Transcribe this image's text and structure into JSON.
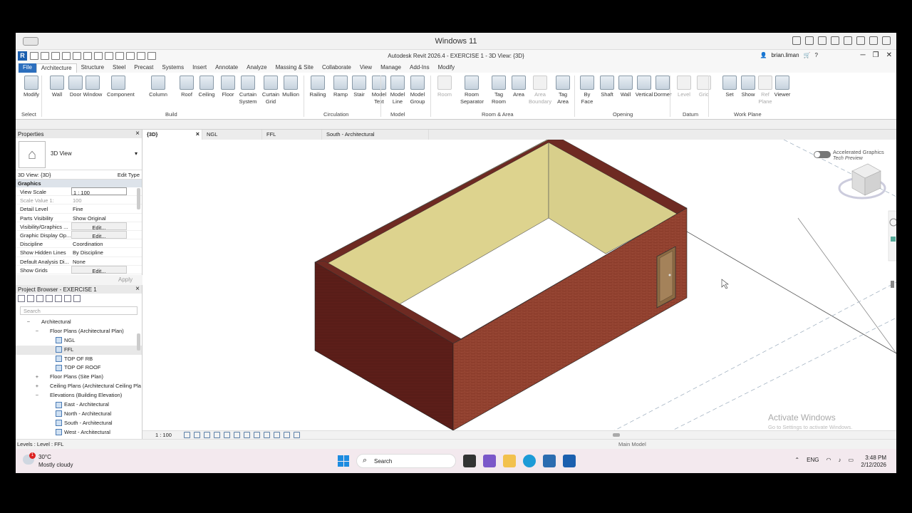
{
  "vm": {
    "title": "Windows 11"
  },
  "app": {
    "title": "Autodesk Revit 2026.4 - EXERCISE 1 - 3D View: {3D}",
    "user": "brian.liman",
    "logo": "R"
  },
  "tabs": [
    "File",
    "Architecture",
    "Structure",
    "Steel",
    "Precast",
    "Systems",
    "Insert",
    "Annotate",
    "Analyze",
    "Massing & Site",
    "Collaborate",
    "View",
    "Manage",
    "Add-Ins",
    "Modify"
  ],
  "ribbon": {
    "tools": [
      {
        "l1": "Modify",
        "l2": ""
      },
      {
        "l1": "Wall",
        "l2": ""
      },
      {
        "l1": "Door",
        "l2": ""
      },
      {
        "l1": "Window",
        "l2": ""
      },
      {
        "l1": "Component",
        "l2": ""
      },
      {
        "l1": "Column",
        "l2": ""
      },
      {
        "l1": "Roof",
        "l2": ""
      },
      {
        "l1": "Ceiling",
        "l2": ""
      },
      {
        "l1": "Floor",
        "l2": ""
      },
      {
        "l1": "Curtain",
        "l2": "System"
      },
      {
        "l1": "Curtain",
        "l2": "Grid"
      },
      {
        "l1": "Mullion",
        "l2": ""
      },
      {
        "l1": "Railing",
        "l2": ""
      },
      {
        "l1": "Ramp",
        "l2": ""
      },
      {
        "l1": "Stair",
        "l2": ""
      },
      {
        "l1": "Model",
        "l2": "Text"
      },
      {
        "l1": "Model",
        "l2": "Line"
      },
      {
        "l1": "Model",
        "l2": "Group"
      },
      {
        "l1": "Room",
        "l2": ""
      },
      {
        "l1": "Room",
        "l2": "Separator"
      },
      {
        "l1": "Tag",
        "l2": "Room"
      },
      {
        "l1": "Area",
        "l2": ""
      },
      {
        "l1": "Area",
        "l2": "Boundary"
      },
      {
        "l1": "Tag",
        "l2": "Area"
      },
      {
        "l1": "By",
        "l2": "Face"
      },
      {
        "l1": "Shaft",
        "l2": ""
      },
      {
        "l1": "Wall",
        "l2": ""
      },
      {
        "l1": "Vertical",
        "l2": ""
      },
      {
        "l1": "Dormer",
        "l2": ""
      },
      {
        "l1": "Level",
        "l2": ""
      },
      {
        "l1": "Grid",
        "l2": ""
      },
      {
        "l1": "Set",
        "l2": ""
      },
      {
        "l1": "Show",
        "l2": ""
      },
      {
        "l1": "Ref",
        "l2": "Plane"
      },
      {
        "l1": "Viewer",
        "l2": ""
      }
    ],
    "panels": [
      "Select",
      "Build",
      "Circulation",
      "Model",
      "Room & Area",
      "Opening",
      "Datum",
      "Work Plane"
    ]
  },
  "properties": {
    "title": "Properties",
    "type_name": "3D View",
    "view_selector": "3D View: {3D}",
    "edit_type": "Edit Type",
    "group": "Graphics",
    "rows": [
      {
        "k": "View Scale",
        "v": "1 : 100"
      },
      {
        "k": "Scale Value    1:",
        "v": "100"
      },
      {
        "k": "Detail Level",
        "v": "Fine"
      },
      {
        "k": "Parts Visibility",
        "v": "Show Original"
      },
      {
        "k": "Visibility/Graphics ...",
        "v": "Edit..."
      },
      {
        "k": "Graphic Display Op...",
        "v": "Edit..."
      },
      {
        "k": "Discipline",
        "v": "Coordination"
      },
      {
        "k": "Show Hidden Lines",
        "v": "By Discipline"
      },
      {
        "k": "Default Analysis Di...",
        "v": "None"
      },
      {
        "k": "Show Grids",
        "v": "Edit..."
      }
    ],
    "apply": "Apply"
  },
  "browser": {
    "title": "Project Browser - EXERCISE 1",
    "search": "Search",
    "nodes": [
      {
        "t": "Architectural",
        "lvl": 1,
        "exp": "−"
      },
      {
        "t": "Floor Plans (Architectural Plan)",
        "lvl": 2,
        "exp": "−"
      },
      {
        "t": "NGL",
        "lvl": 3,
        "exp": ""
      },
      {
        "t": "FFL",
        "lvl": 3,
        "exp": ""
      },
      {
        "t": "TOP OF RB",
        "lvl": 3,
        "exp": ""
      },
      {
        "t": "TOP OF ROOF",
        "lvl": 3,
        "exp": ""
      },
      {
        "t": "Floor Plans (Site Plan)",
        "lvl": 2,
        "exp": "+"
      },
      {
        "t": "Ceiling Plans (Architectural Ceiling Pla",
        "lvl": 2,
        "exp": "+"
      },
      {
        "t": "Elevations (Building Elevation)",
        "lvl": 2,
        "exp": "−"
      },
      {
        "t": "East - Architectural",
        "lvl": 3,
        "exp": ""
      },
      {
        "t": "North - Architectural",
        "lvl": 3,
        "exp": ""
      },
      {
        "t": "South - Architectural",
        "lvl": 3,
        "exp": ""
      },
      {
        "t": "West - Architectural",
        "lvl": 3,
        "exp": ""
      }
    ]
  },
  "view_tabs": [
    "{3D}",
    "NGL",
    "FFL",
    "South - Architectural"
  ],
  "viewport": {
    "accel_title": "Accelerated Graphics",
    "accel_sub": "Tech Preview",
    "watermark1": "Activate Windows",
    "watermark2": "Go to Settings to activate Windows.",
    "scale": "1 : 100"
  },
  "status": {
    "text": "Levels : Level : FFL",
    "model": "Main Model"
  },
  "taskbar": {
    "temp": "30°C",
    "weather": "Mostly cloudy",
    "badge": "1",
    "search": "Search",
    "lang": "ENG",
    "time": "3:48 PM",
    "date": "2/12/2026"
  }
}
